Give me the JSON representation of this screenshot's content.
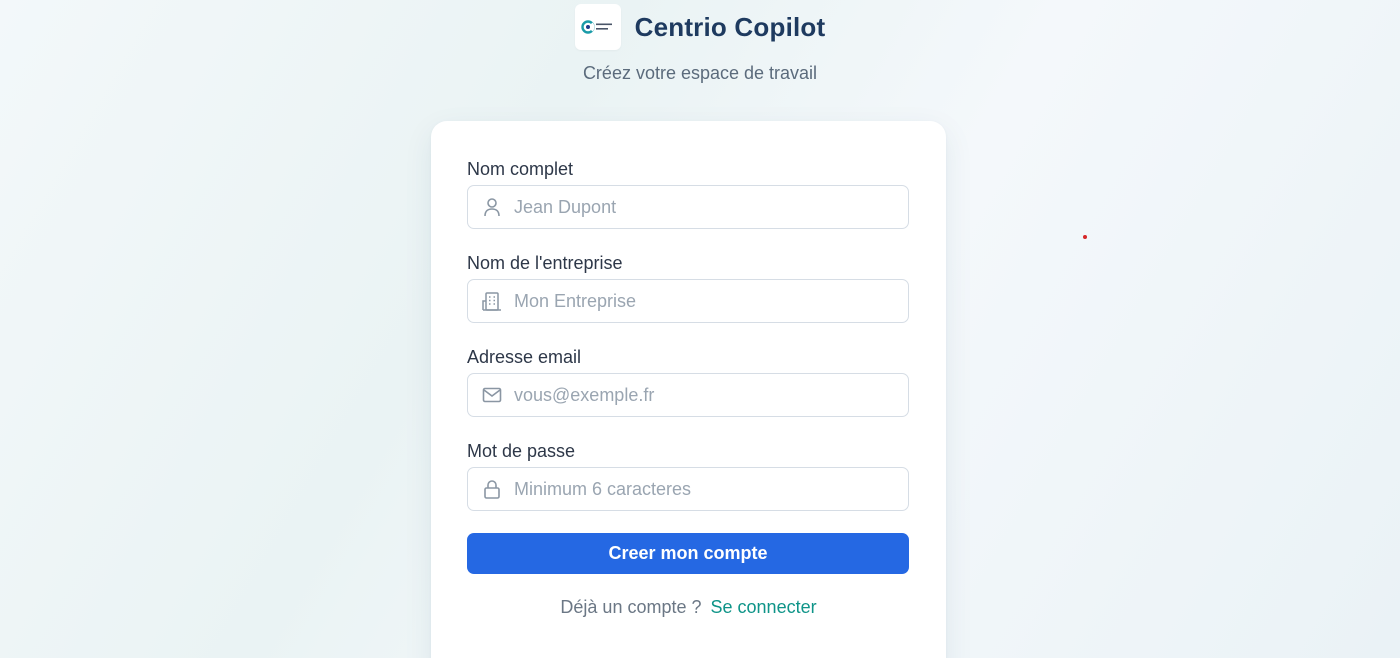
{
  "header": {
    "logo_icon": "centrio-copilot-logo",
    "title": "Centrio Copilot",
    "subtitle": "Créez votre espace de travail"
  },
  "form": {
    "fields": [
      {
        "label": "Nom complet",
        "placeholder": "Jean Dupont",
        "value": "",
        "icon": "user-icon"
      },
      {
        "label": "Nom de l'entreprise",
        "placeholder": "Mon Entreprise",
        "value": "",
        "icon": "building-icon"
      },
      {
        "label": "Adresse email",
        "placeholder": "vous@exemple.fr",
        "value": "",
        "icon": "mail-icon"
      },
      {
        "label": "Mot de passe",
        "placeholder": "Minimum 6 caracteres",
        "value": "",
        "icon": "lock-icon"
      }
    ],
    "submit_label": "Creer mon compte",
    "login_prompt": "Déjà un compte ?",
    "login_link": "Se connecter"
  },
  "colors": {
    "title": "#1e3a5f",
    "primary_button": "#2568e3",
    "link": "#0e9488",
    "indicator_dot": "#d62828"
  }
}
